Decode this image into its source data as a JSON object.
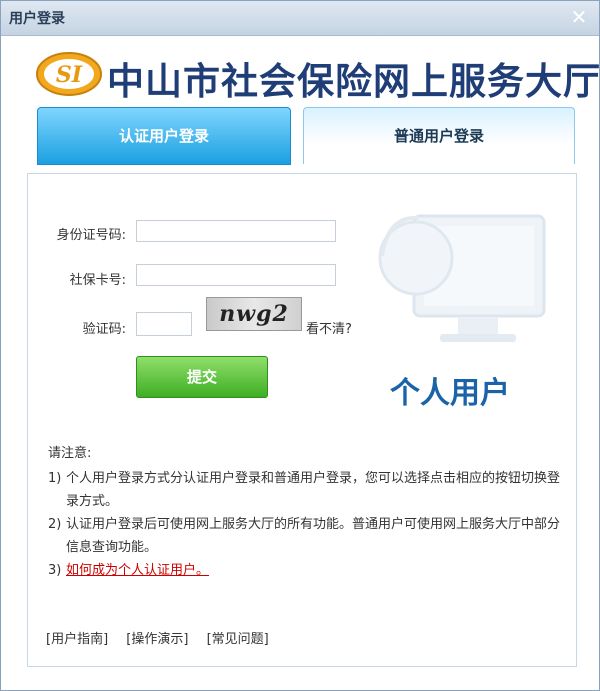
{
  "window": {
    "title": "用户登录",
    "close_symbol": "✕"
  },
  "header": {
    "logo_text": "SI",
    "site_title": "中山市社会保险网上服务大厅"
  },
  "tabs": [
    {
      "label": "认证用户登录",
      "active": false
    },
    {
      "label": "普通用户登录",
      "active": true
    }
  ],
  "form": {
    "id_label": "身份证号码:",
    "id_value": "",
    "card_label": "社保卡号:",
    "card_value": "",
    "captcha_label": "验证码:",
    "captcha_value": "",
    "captcha_image_text": "nwg2",
    "refresh_label": "看不清?",
    "submit_label": "提交"
  },
  "banner": {
    "user_type_label": "个人用户"
  },
  "notes": {
    "title": "请注意:",
    "items": [
      {
        "num": "1)",
        "text": "个人用户登录方式分认证用户登录和普通用户登录，您可以选择点击相应的按钮切换登录方式。"
      },
      {
        "num": "2)",
        "text": "认证用户登录后可使用网上服务大厅的所有功能。普通用户可使用网上服务大厅中部分信息查询功能。"
      },
      {
        "num": "3)",
        "link": "如何成为个人认证用户。"
      }
    ]
  },
  "footer_links": [
    "[用户指南]",
    "[操作演示]",
    "[常见问题]"
  ],
  "colors": {
    "accent_blue": "#1ba0e0",
    "submit_green": "#3fae24",
    "title_navy": "#1f3d76",
    "link_red": "#cc0000"
  }
}
